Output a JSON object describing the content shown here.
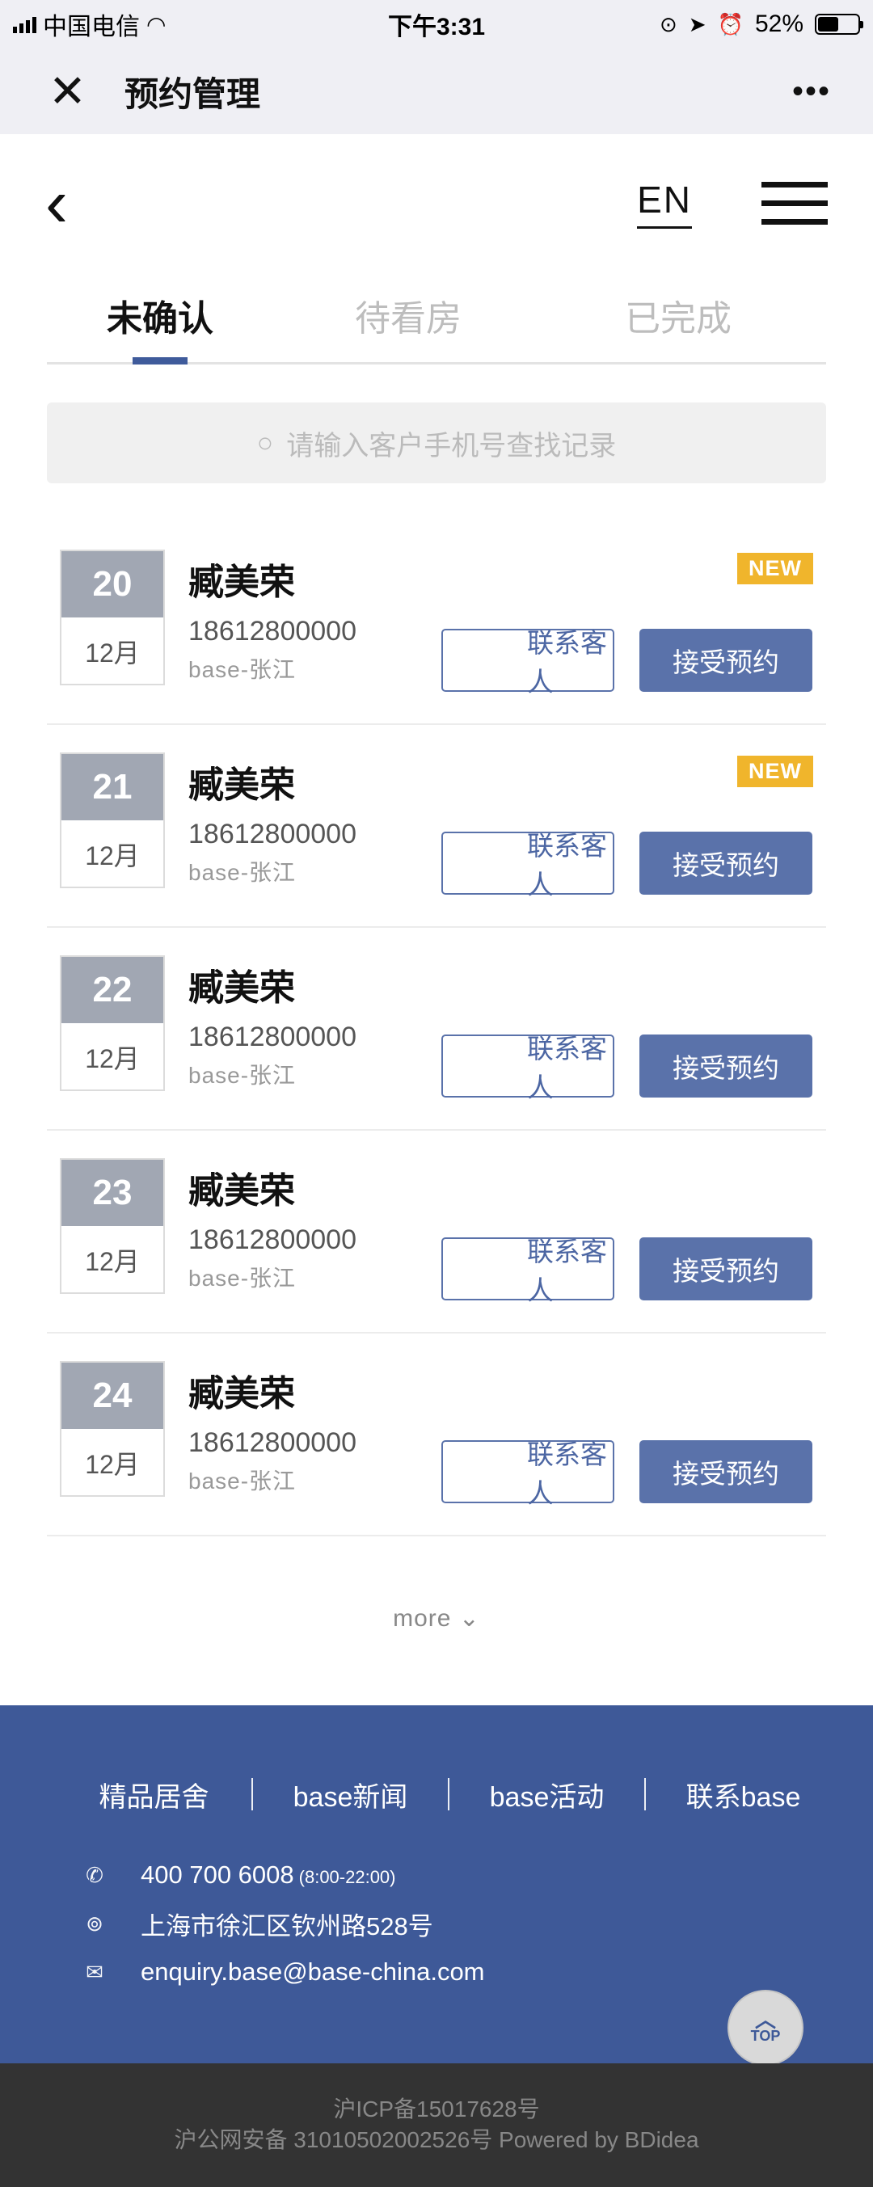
{
  "status_bar": {
    "carrier": "中国电信",
    "time": "下午3:31",
    "battery": "52%"
  },
  "wx_nav": {
    "close": "✕",
    "title": "预约管理",
    "more": "•••"
  },
  "site_header": {
    "back": "‹",
    "lang": "EN"
  },
  "tabs": [
    {
      "label": "未确认",
      "active": true
    },
    {
      "label": "待看房",
      "active": false
    },
    {
      "label": "已完成",
      "active": false
    }
  ],
  "search": {
    "placeholder": "请输入客户手机号查找记录"
  },
  "rows": [
    {
      "day": "20",
      "month": "12月",
      "name": "臧美荣",
      "phone": "18612800000",
      "location": "base-张江",
      "badge": "NEW",
      "contact": "联系客人",
      "accept": "接受预约"
    },
    {
      "day": "21",
      "month": "12月",
      "name": "臧美荣",
      "phone": "18612800000",
      "location": "base-张江",
      "badge": "NEW",
      "contact": "联系客人",
      "accept": "接受预约"
    },
    {
      "day": "22",
      "month": "12月",
      "name": "臧美荣",
      "phone": "18612800000",
      "location": "base-张江",
      "badge": "",
      "contact": "联系客人",
      "accept": "接受预约"
    },
    {
      "day": "23",
      "month": "12月",
      "name": "臧美荣",
      "phone": "18612800000",
      "location": "base-张江",
      "badge": "",
      "contact": "联系客人",
      "accept": "接受预约"
    },
    {
      "day": "24",
      "month": "12月",
      "name": "臧美荣",
      "phone": "18612800000",
      "location": "base-张江",
      "badge": "",
      "contact": "联系客人",
      "accept": "接受预约"
    }
  ],
  "more": "more ⌄",
  "footer": {
    "nav": [
      "精品居舍",
      "base新闻",
      "base活动",
      "联系base"
    ],
    "phone": "400 700 6008",
    "hours": "(8:00-22:00)",
    "address": "上海市徐汇区钦州路528号",
    "email": "enquiry.base@base-china.com",
    "top": "TOP"
  },
  "bottom": {
    "icp": "沪ICP备15017628号",
    "police": "沪公网安备 31010502002526号   Powered by BDidea"
  },
  "colors": {
    "primary": "#3e5998",
    "button": "#5a72aa",
    "badge": "#f0b52c"
  }
}
